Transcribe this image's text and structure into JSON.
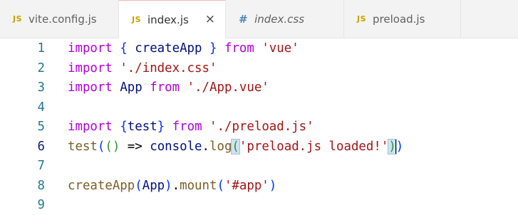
{
  "tabs": [
    {
      "icon": "JS",
      "label": "vite.config.js",
      "active": false
    },
    {
      "icon": "JS",
      "label": "index.js",
      "active": true,
      "close": "×"
    },
    {
      "icon": "#",
      "label": "index.css",
      "active": false
    },
    {
      "icon": "JS",
      "label": "preload.js",
      "active": false
    }
  ],
  "lines": [
    {
      "num": "1",
      "tokens": [
        [
          "kw",
          "import"
        ],
        [
          "punc",
          " "
        ],
        [
          "b1",
          "{"
        ],
        [
          "plain",
          " createApp "
        ],
        [
          "b1",
          "}"
        ],
        [
          "punc",
          " "
        ],
        [
          "kw",
          "from"
        ],
        [
          "punc",
          " "
        ],
        [
          "str",
          "'vue'"
        ]
      ]
    },
    {
      "num": "2",
      "tokens": [
        [
          "kw",
          "import"
        ],
        [
          "punc",
          " "
        ],
        [
          "str",
          "'./index.css'"
        ]
      ]
    },
    {
      "num": "3",
      "tokens": [
        [
          "kw",
          "import"
        ],
        [
          "punc",
          " "
        ],
        [
          "plain",
          "App"
        ],
        [
          "punc",
          " "
        ],
        [
          "kw",
          "from"
        ],
        [
          "punc",
          " "
        ],
        [
          "str",
          "'./App.vue'"
        ]
      ]
    },
    {
      "num": "4",
      "tokens": []
    },
    {
      "num": "5",
      "tokens": [
        [
          "kw",
          "import"
        ],
        [
          "punc",
          " "
        ],
        [
          "b1",
          "{"
        ],
        [
          "plain",
          "test"
        ],
        [
          "b1",
          "}"
        ],
        [
          "punc",
          " "
        ],
        [
          "kw",
          "from"
        ],
        [
          "punc",
          " "
        ],
        [
          "str",
          "'./preload.js'"
        ]
      ]
    },
    {
      "num": "6",
      "tokens": [
        [
          "fn",
          "test"
        ],
        [
          "b1",
          "("
        ],
        [
          "b2",
          "()"
        ],
        [
          "op",
          " => "
        ],
        [
          "plain",
          "console"
        ],
        [
          "punc",
          "."
        ],
        [
          "fn",
          "log"
        ],
        [
          "b2h",
          "("
        ],
        [
          "str",
          "'preload.js loaded!'"
        ],
        [
          "b2h",
          ")"
        ],
        [
          "cur",
          ""
        ],
        [
          "b1",
          ")"
        ]
      ]
    },
    {
      "num": "7",
      "tokens": []
    },
    {
      "num": "8",
      "tokens": [
        [
          "fn",
          "createApp"
        ],
        [
          "b1",
          "("
        ],
        [
          "plain",
          "App"
        ],
        [
          "b1",
          ")"
        ],
        [
          "punc",
          "."
        ],
        [
          "fn",
          "mount"
        ],
        [
          "b1",
          "("
        ],
        [
          "str",
          "'#app'"
        ],
        [
          "b1",
          ")"
        ]
      ]
    },
    {
      "num": "9",
      "tokens": []
    }
  ],
  "current_line": "6",
  "colors": {
    "keyword": "#af00db",
    "string": "#a31515",
    "function": "#795e26",
    "variable": "#001080",
    "line_number": "#237893",
    "active_tab_top_border": "#f0b7b7"
  }
}
